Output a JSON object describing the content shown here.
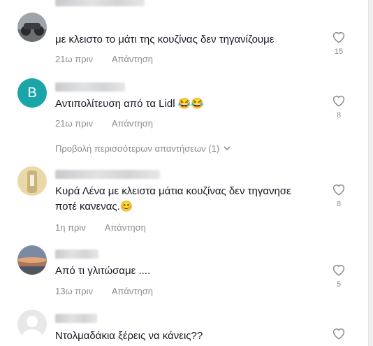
{
  "comments": [
    {
      "text": "με κλειστο το μάτι της κουζίνας δεν τηγανίζουμε",
      "time": "21ω πριν",
      "reply": "Απάντηση",
      "likes": "15",
      "avatar": "photo-moto"
    },
    {
      "text": "Αντιπολίτευση από τα Lidl 😂😂",
      "time": "21ω πριν",
      "reply": "Απάντηση",
      "likes": "8",
      "avatar_letter": "B",
      "avatar_color": "#1aa5a8"
    },
    {
      "text_line1": "Κυρά Λένα με κλειστα μάτια κουζίνας δεν τηγανησε",
      "text_line2": "ποτέ κανενας.😊",
      "time": "1η πριν",
      "reply": "Απάντηση",
      "likes": "8",
      "avatar": "photo-bottle"
    },
    {
      "text": "Από τι γλιτώσαμε ....",
      "time": "13ω πριν",
      "reply": "Απάντηση",
      "likes": "5",
      "avatar": "photo-sunset"
    },
    {
      "text": "Ντολμαδάκια ξέρεις να κάνεις??",
      "avatar": "default-user"
    }
  ],
  "view_more": "Προβολή περισσότερων απαντήσεων (1)",
  "colors": {
    "text": "#161823",
    "muted": "#8a8b91",
    "accent_avatar": "#1aa5a8"
  }
}
